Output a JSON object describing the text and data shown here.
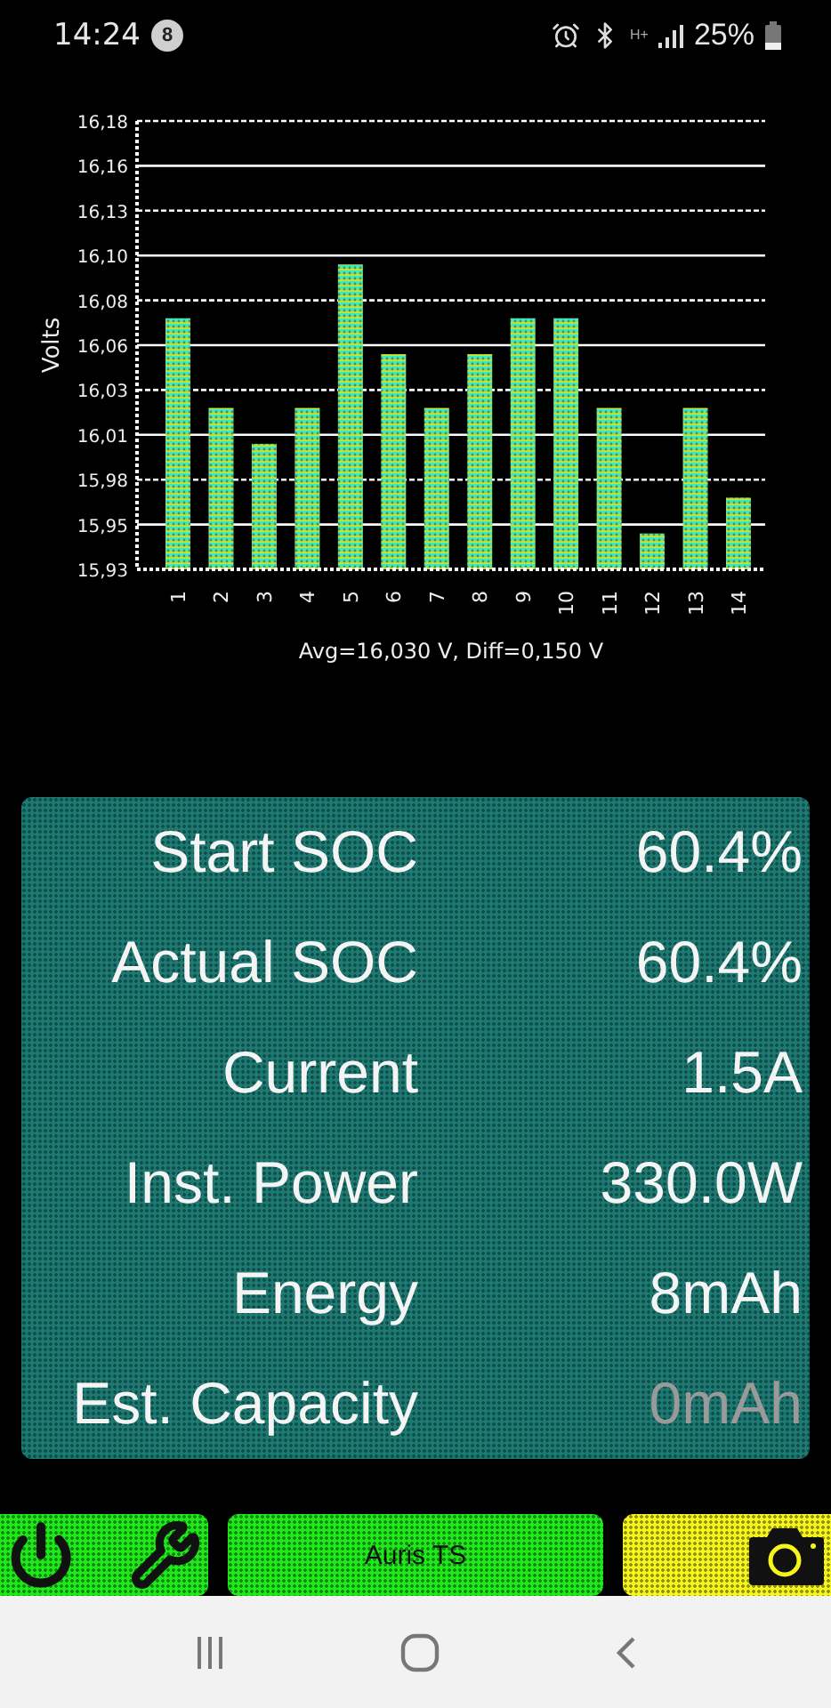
{
  "status_bar": {
    "time": "14:24",
    "notification_count": "8",
    "network": "H+",
    "battery": "25%"
  },
  "chart": {
    "chart_data": {
      "type": "bar",
      "ylabel": "Volts",
      "xlabel": "Avg=16,030 V, Diff=0,150 V",
      "categories": [
        "1",
        "2",
        "3",
        "4",
        "5",
        "6",
        "7",
        "8",
        "9",
        "10",
        "11",
        "12",
        "13",
        "14"
      ],
      "values": [
        16.07,
        16.02,
        16.0,
        16.02,
        16.1,
        16.05,
        16.02,
        16.05,
        16.07,
        16.07,
        16.02,
        15.95,
        16.02,
        15.97
      ],
      "ylim": [
        15.93,
        16.18
      ],
      "grid": true,
      "yticks": [
        {
          "value": 15.93,
          "label": "15,93"
        },
        {
          "value": 15.955,
          "label": "15,95"
        },
        {
          "value": 15.98,
          "label": "15,98"
        },
        {
          "value": 16.005,
          "label": "16,01"
        },
        {
          "value": 16.03,
          "label": "16,03"
        },
        {
          "value": 16.055,
          "label": "16,06"
        },
        {
          "value": 16.08,
          "label": "16,08"
        },
        {
          "value": 16.105,
          "label": "16,10"
        },
        {
          "value": 16.13,
          "label": "16,13"
        },
        {
          "value": 16.155,
          "label": "16,16"
        },
        {
          "value": 16.18,
          "label": "16,18"
        }
      ]
    }
  },
  "stats": [
    {
      "label": "Start SOC",
      "value": "60.4%",
      "dimmed": false
    },
    {
      "label": "Actual SOC",
      "value": "60.4%",
      "dimmed": false
    },
    {
      "label": "Current",
      "value": "1.5A",
      "dimmed": false
    },
    {
      "label": "Inst. Power",
      "value": "330.0W",
      "dimmed": false
    },
    {
      "label": "Energy",
      "value": "8mAh",
      "dimmed": false
    },
    {
      "label": "Est. Capacity",
      "value": "0mAh",
      "dimmed": true
    }
  ],
  "bottom_bar": {
    "title": "Auris TS"
  }
}
